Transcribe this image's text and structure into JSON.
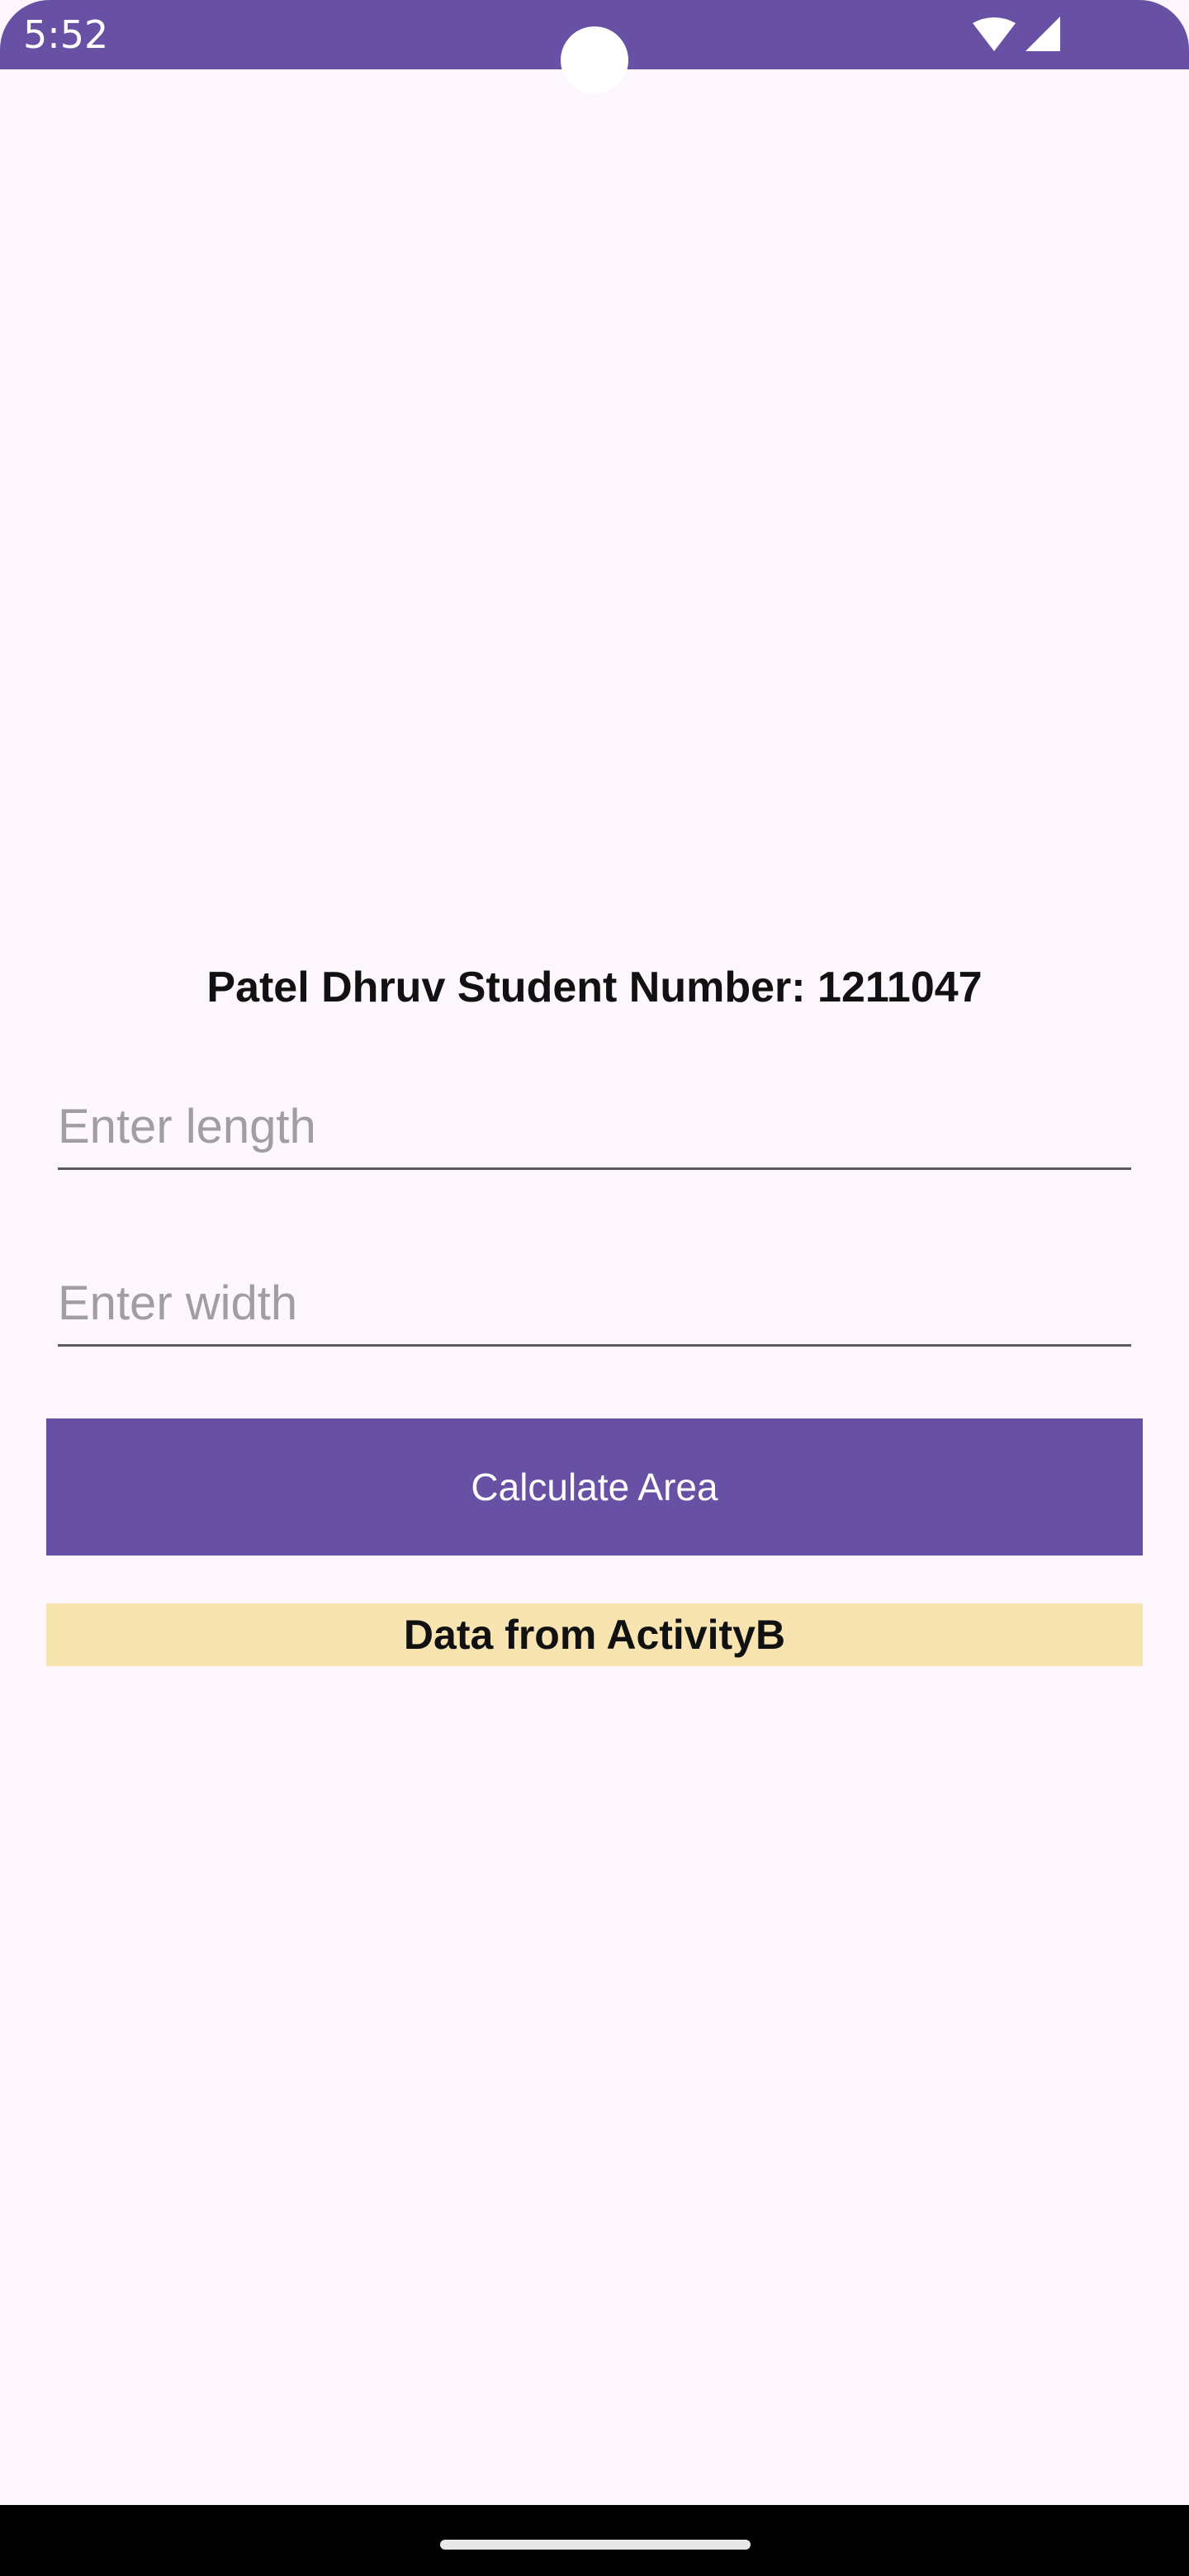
{
  "status_bar": {
    "time": "5:52",
    "icons": [
      "wifi-icon",
      "signal-icon"
    ],
    "color": "#6851a4"
  },
  "main": {
    "title": "Patel Dhruv Student Number: 1211047",
    "length_field": {
      "placeholder": "Enter length",
      "value": ""
    },
    "width_field": {
      "placeholder": "Enter width",
      "value": ""
    },
    "calculate_button": {
      "label": "Calculate Area",
      "color": "#6851a4"
    },
    "result_text": {
      "label": "Data from ActivityB",
      "background": "#f7e4b1"
    }
  },
  "colors": {
    "background": "#fdf7fd",
    "accent": "#6851a4"
  }
}
